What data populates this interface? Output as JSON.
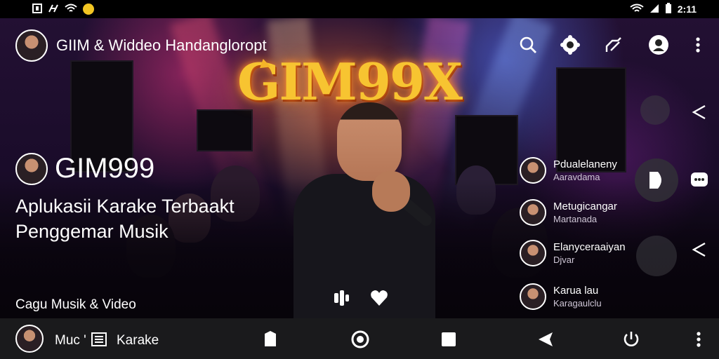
{
  "status_bar": {
    "left_icons": [
      "message-icon",
      "signal-icon",
      "wifi-icon",
      "notification-icon"
    ],
    "right_icons": [
      "wifi-icon",
      "cell-signal-icon",
      "battery-icon"
    ],
    "time": "2:11",
    "accent": "#f3c623"
  },
  "app_bar": {
    "title": "GIIM & Widdeo Handangloropt",
    "icons": [
      "search-icon",
      "settings-icon",
      "share-icon",
      "account-icon",
      "more-vert-icon"
    ]
  },
  "banner": {
    "logo_text": "GIM99X",
    "logo_color": "#f7c431"
  },
  "channel": {
    "name": "GIM999",
    "description": "Aplukasii Karake Terbaakt Penggemar Musik",
    "category": "Cagu  Musik & Video"
  },
  "center_controls": [
    "mic-icon",
    "heart-icon"
  ],
  "people": [
    {
      "name": "Pdualelaneny",
      "subtitle": "Aaravdama"
    },
    {
      "name": "Metugicangar",
      "subtitle": "Martanada"
    },
    {
      "name": "Elanyceraaiyan",
      "subtitle": "Djvar"
    },
    {
      "name": "Karua lau",
      "subtitle": "Karagaulclu"
    }
  ],
  "side_controls": [
    "share-icon",
    "play-icon",
    "chat-icon",
    "share-icon"
  ],
  "bottom_bar": {
    "label_left": "Muc '",
    "label_right": "Karake",
    "icons": [
      "playlist-icon",
      "tag-icon",
      "record-icon",
      "stop-icon",
      "volume-icon",
      "power-icon",
      "more-vert-icon"
    ]
  }
}
